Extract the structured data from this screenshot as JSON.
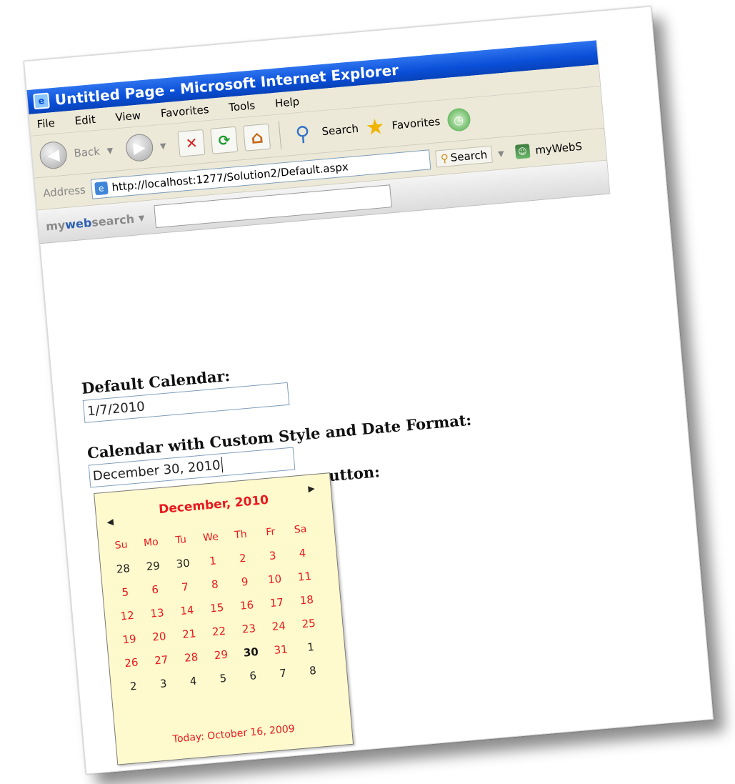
{
  "window": {
    "title": "Untitled Page - Microsoft Internet Explorer"
  },
  "menu": [
    "File",
    "Edit",
    "View",
    "Favorites",
    "Tools",
    "Help"
  ],
  "toolbar": {
    "back_label": "Back",
    "search_label": "Search",
    "favorites_label": "Favorites"
  },
  "address": {
    "label": "Address",
    "url": "http://localhost:1277/Solution2/Default.aspx",
    "search_label": "Search",
    "mywebsearch_trunc": "myWebS"
  },
  "mws": {
    "logo_my": "my",
    "logo_web": "web",
    "logo_search": "search"
  },
  "form": {
    "label1": "Default Calendar:",
    "value1": "1/7/2010",
    "label2": "Calendar with Custom Style and Date Format:",
    "value2": "December 30, 2010",
    "label3_visible": "utton:"
  },
  "calendar": {
    "title": "December, 2010",
    "days_of_week": [
      "Su",
      "Mo",
      "Tu",
      "We",
      "Th",
      "Fr",
      "Sa"
    ],
    "weeks": [
      [
        {
          "d": "28",
          "t": "other"
        },
        {
          "d": "29",
          "t": "other"
        },
        {
          "d": "30",
          "t": "other"
        },
        {
          "d": "1",
          "t": "cur"
        },
        {
          "d": "2",
          "t": "cur"
        },
        {
          "d": "3",
          "t": "cur"
        },
        {
          "d": "4",
          "t": "cur"
        }
      ],
      [
        {
          "d": "5",
          "t": "cur"
        },
        {
          "d": "6",
          "t": "cur"
        },
        {
          "d": "7",
          "t": "cur"
        },
        {
          "d": "8",
          "t": "cur"
        },
        {
          "d": "9",
          "t": "cur"
        },
        {
          "d": "10",
          "t": "cur"
        },
        {
          "d": "11",
          "t": "cur"
        }
      ],
      [
        {
          "d": "12",
          "t": "cur"
        },
        {
          "d": "13",
          "t": "cur"
        },
        {
          "d": "14",
          "t": "cur"
        },
        {
          "d": "15",
          "t": "cur"
        },
        {
          "d": "16",
          "t": "cur"
        },
        {
          "d": "17",
          "t": "cur"
        },
        {
          "d": "18",
          "t": "cur"
        }
      ],
      [
        {
          "d": "19",
          "t": "cur"
        },
        {
          "d": "20",
          "t": "cur"
        },
        {
          "d": "21",
          "t": "cur"
        },
        {
          "d": "22",
          "t": "cur"
        },
        {
          "d": "23",
          "t": "cur"
        },
        {
          "d": "24",
          "t": "cur"
        },
        {
          "d": "25",
          "t": "cur"
        }
      ],
      [
        {
          "d": "26",
          "t": "cur"
        },
        {
          "d": "27",
          "t": "cur"
        },
        {
          "d": "28",
          "t": "cur"
        },
        {
          "d": "29",
          "t": "cur"
        },
        {
          "d": "30",
          "t": "sel"
        },
        {
          "d": "31",
          "t": "cur"
        },
        {
          "d": "1",
          "t": "other"
        }
      ],
      [
        {
          "d": "2",
          "t": "other"
        },
        {
          "d": "3",
          "t": "other"
        },
        {
          "d": "4",
          "t": "other"
        },
        {
          "d": "5",
          "t": "other"
        },
        {
          "d": "6",
          "t": "other"
        },
        {
          "d": "7",
          "t": "other"
        },
        {
          "d": "8",
          "t": "other"
        }
      ]
    ],
    "today_text": "Today: October 16, 2009",
    "colors": {
      "accent": "#e8191f",
      "background": "#fffacd"
    }
  }
}
